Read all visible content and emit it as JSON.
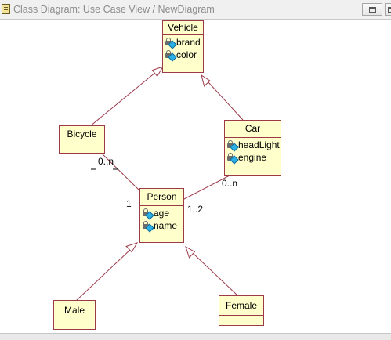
{
  "window": {
    "title": "Class Diagram: Use Case View / NewDiagram"
  },
  "diagram": {
    "classes": [
      {
        "name": "Vehicle",
        "attributes": [
          "brand",
          "color"
        ]
      },
      {
        "name": "Bicycle",
        "attributes": []
      },
      {
        "name": "Car",
        "attributes": [
          "headLight",
          "engine"
        ]
      },
      {
        "name": "Person",
        "attributes": [
          "age",
          "name"
        ]
      },
      {
        "name": "Male",
        "attributes": []
      },
      {
        "name": "Female",
        "attributes": []
      }
    ],
    "multiplicities": {
      "bicycle_end": "0..n",
      "bicycle_person_end": "1",
      "car_end": "0..n",
      "car_person_end": "1..2"
    }
  },
  "colors": {
    "class_fill": "#ffffcc",
    "class_border": "#9c3a4a",
    "link_line": "#9c3a4a"
  },
  "icons": {
    "attribute": "private-attribute-lock-icon"
  }
}
